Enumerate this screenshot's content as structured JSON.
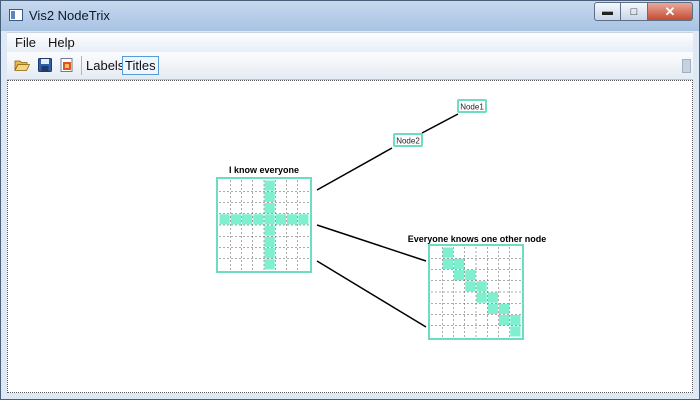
{
  "window": {
    "title": "Vis2 NodeTrix"
  },
  "menu": {
    "items": [
      "File",
      "Help"
    ]
  },
  "toolbar": {
    "open_icon": "folder-open-icon",
    "save_icon": "save-disk-icon",
    "export_icon": "export-icon",
    "labels_label": "Labels",
    "titles_label": "Titles",
    "titles_active": true
  },
  "graph": {
    "nodes": [
      "Node1",
      "Node2"
    ],
    "matrices": [
      {
        "title": "I know everyone",
        "size": 8
      },
      {
        "title": "Everyone knows one other node",
        "size": 8
      }
    ],
    "colors": {
      "cell": "#7ff0cf",
      "border": "#6edcc0",
      "edge": "#000000"
    }
  }
}
